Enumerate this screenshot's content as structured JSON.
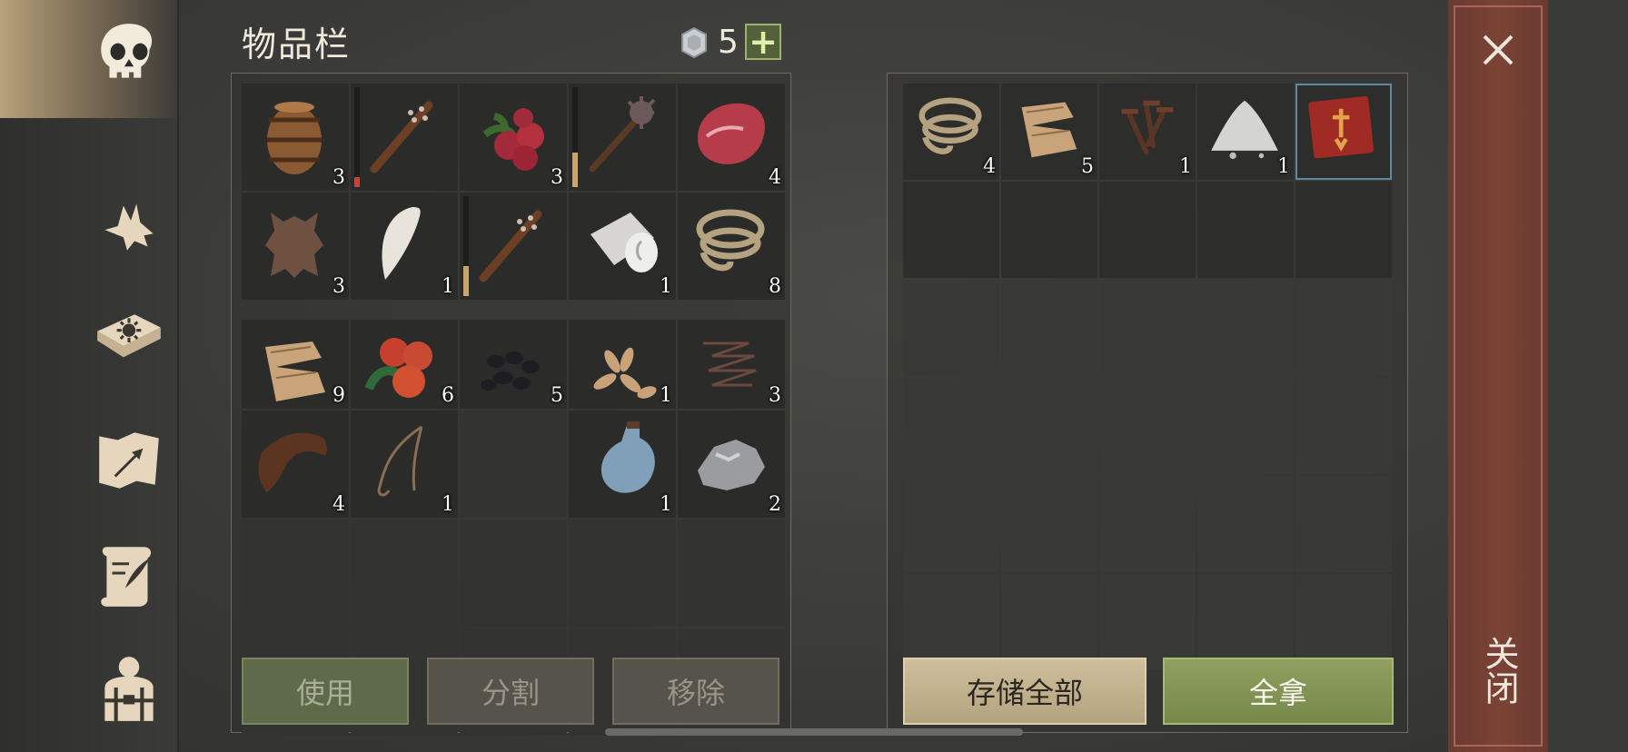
{
  "inventory": {
    "title": "物品栏",
    "coins": "5",
    "plus_label": "+",
    "slots": [
      {
        "item": "barrel",
        "qty": "3"
      },
      {
        "item": "spiked-club",
        "qty": "",
        "durability": 0.1,
        "dur_color": "#c0463b"
      },
      {
        "item": "red-berries",
        "qty": "3"
      },
      {
        "item": "mace",
        "qty": "",
        "durability": 0.35,
        "dur_color": "#c9a66b"
      },
      {
        "item": "raw-meat",
        "qty": "4"
      },
      {
        "item": "animal-hide",
        "qty": "3"
      },
      {
        "item": "fang",
        "qty": "1"
      },
      {
        "item": "spiked-club",
        "qty": "",
        "durability": 0.3,
        "dur_color": "#c9a66b"
      },
      {
        "item": "cloth-roll",
        "qty": "1"
      },
      {
        "item": "rope",
        "qty": "8"
      },
      {
        "item": "fabric",
        "qty": "9"
      },
      {
        "item": "rosehip",
        "qty": "6"
      },
      {
        "item": "coal",
        "qty": "5"
      },
      {
        "item": "seeds",
        "qty": "1"
      },
      {
        "item": "wire",
        "qty": "3"
      },
      {
        "item": "leather",
        "qty": "4"
      },
      {
        "item": "string",
        "qty": "1"
      },
      {
        "item": "",
        "qty": ""
      },
      {
        "item": "flask",
        "qty": "1"
      },
      {
        "item": "stone-ore",
        "qty": "2"
      }
    ],
    "buttons": {
      "use": "使用",
      "split": "分割",
      "remove": "移除"
    }
  },
  "container": {
    "slots": [
      {
        "item": "rope",
        "qty": "4"
      },
      {
        "item": "fabric",
        "qty": "5"
      },
      {
        "item": "nails",
        "qty": "1"
      },
      {
        "item": "powder",
        "qty": "1"
      },
      {
        "item": "red-book",
        "qty": "",
        "selected": true
      }
    ],
    "buttons": {
      "store_all": "存储全部",
      "take_all": "全拿"
    }
  },
  "close": {
    "label": "关闭"
  },
  "nav": {
    "items": [
      "skull-icon",
      "wolf-icon",
      "sun-book-icon",
      "hammer-map-icon",
      "scroll-feather-icon",
      "character-gear-icon"
    ]
  }
}
